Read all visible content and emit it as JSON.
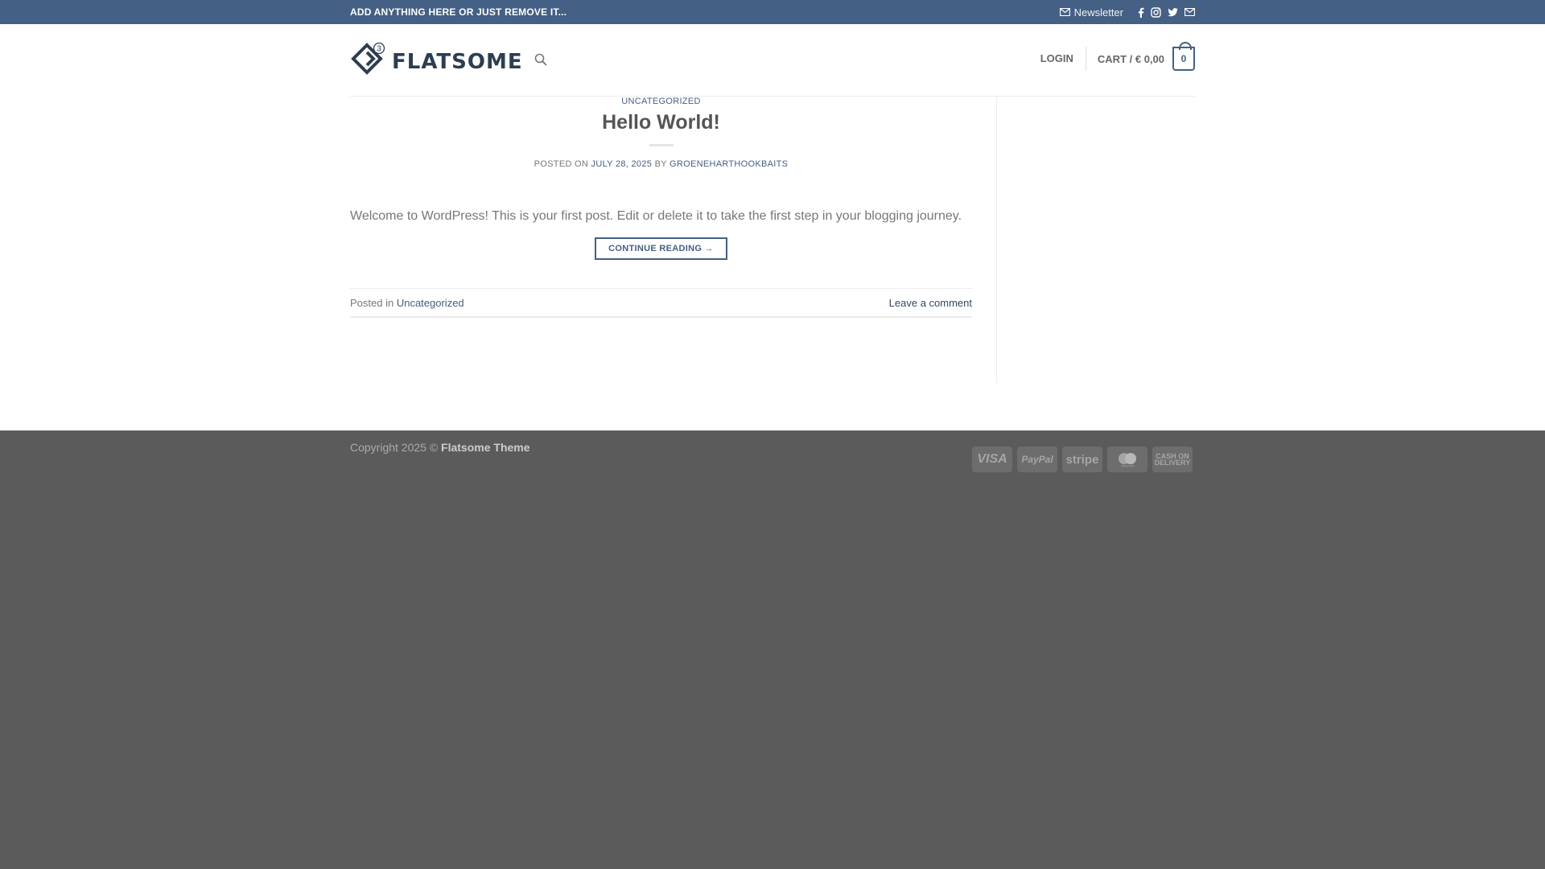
{
  "topbar": {
    "message": "ADD ANYTHING HERE OR JUST REMOVE IT...",
    "newsletter_label": "Newsletter",
    "social_icons": [
      "facebook-icon",
      "instagram-icon",
      "twitter-icon",
      "email-icon"
    ]
  },
  "header": {
    "logo_text": "FLATSOME",
    "logo_badge": "3",
    "login_label": "LOGIN",
    "cart_label": "CART / € 0,00",
    "cart_count": "0"
  },
  "post": {
    "category": "UNCATEGORIZED",
    "title": "Hello World!",
    "posted_on_label": "POSTED ON",
    "date": "JULY 28, 2025",
    "by_label": "BY",
    "author": "GROENEHARTHOOKBAITS",
    "excerpt": "Welcome to WordPress! This is your first post. Edit or delete it to take the first step in your blogging journey.",
    "continue_label": "CONTINUE READING →",
    "posted_in_label": "Posted in",
    "posted_in_category": "Uncategorized",
    "comment_label": "Leave a comment"
  },
  "footer": {
    "copyright_prefix": "Copyright 2025 ©",
    "copyright_name": "Flatsome Theme",
    "payments": [
      "VISA",
      "PayPal",
      "stripe",
      "mastercard",
      "CASH ON DELIVERY"
    ]
  },
  "colors": {
    "primary": "#446084",
    "footer_bg": "#5b5b5b"
  }
}
